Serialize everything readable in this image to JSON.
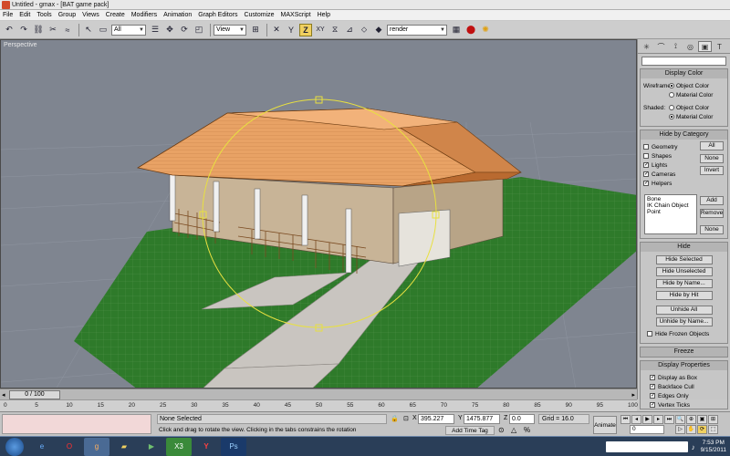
{
  "window": {
    "title": "Untitled - gmax - [BAT game pack]"
  },
  "menu": [
    "File",
    "Edit",
    "Tools",
    "Group",
    "Views",
    "Create",
    "Modifiers",
    "Animation",
    "Graph Editors",
    "Customize",
    "MAXScript",
    "Help"
  ],
  "toolbar": {
    "selection_filter": "All",
    "ref_coord": "View",
    "named_selection": "render",
    "constraint_z": "Z",
    "constraint_xy": "XY"
  },
  "viewport": {
    "label": "Perspective"
  },
  "command_panel": {
    "display_color": {
      "title": "Display Color",
      "wireframe_label": "Wireframe:",
      "shaded_label": "Shaded:",
      "object_color": "Object Color",
      "material_color": "Material Color"
    },
    "hide_by_category": {
      "title": "Hide by Category",
      "categories": [
        {
          "label": "Geometry",
          "checked": false
        },
        {
          "label": "Shapes",
          "checked": false
        },
        {
          "label": "Lights",
          "checked": true
        },
        {
          "label": "Cameras",
          "checked": true
        },
        {
          "label": "Helpers",
          "checked": true
        }
      ],
      "all_btn": "All",
      "none_btn": "None",
      "invert_btn": "Invert",
      "list": [
        "Bone",
        "IK Chain Object",
        "Point"
      ],
      "add_btn": "Add",
      "remove_btn": "Remove",
      "none2_btn": "None"
    },
    "hide": {
      "title": "Hide",
      "buttons": [
        "Hide Selected",
        "Hide Unselected",
        "Hide by Name...",
        "Hide by Hit",
        "Unhide All",
        "Unhide by Name..."
      ],
      "hide_frozen": "Hide Frozen Objects"
    },
    "freeze": {
      "title": "Freeze"
    },
    "display_properties": {
      "title": "Display Properties",
      "items": [
        {
          "label": "Display as Box",
          "checked": true
        },
        {
          "label": "Backface Cull",
          "checked": true
        },
        {
          "label": "Edges Only",
          "checked": true
        },
        {
          "label": "Vertex Ticks",
          "checked": true
        }
      ]
    }
  },
  "timeline": {
    "slider": "0 / 100",
    "ticks": [
      "0",
      "5",
      "10",
      "15",
      "20",
      "25",
      "30",
      "35",
      "40",
      "45",
      "50",
      "55",
      "60",
      "65",
      "70",
      "75",
      "80",
      "85",
      "90",
      "95",
      "100"
    ]
  },
  "status": {
    "selection": "None Selected",
    "prompt": "Click and drag to rotate the view.  Clicking in the tabs constrains the rotation",
    "x_label": "X",
    "x_value": "395.227",
    "y_label": "Y",
    "y_value": "1475.877",
    "z_label": "Z",
    "z_value": "0.0",
    "grid": "Grid = 16.0",
    "add_time_tag": "Add Time Tag",
    "animate": "Animate",
    "frame": "0"
  },
  "taskbar": {
    "time": "7:53 PM",
    "date": "9/15/2011",
    "apps": [
      "ie-icon",
      "opera-icon",
      "gmax-icon",
      "folder-icon",
      "media-icon",
      "x3-icon",
      "yahoo-icon",
      "photoshop-icon"
    ]
  }
}
